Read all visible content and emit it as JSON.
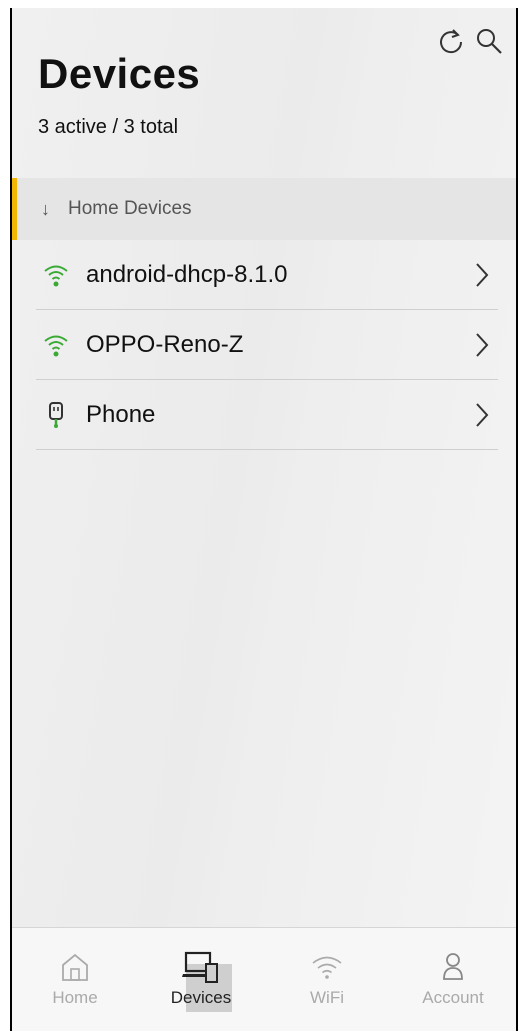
{
  "header": {
    "title": "Devices",
    "summary": "3 active / 3 total",
    "refresh_icon": "refresh-icon",
    "search_icon": "search-icon"
  },
  "section": {
    "label": "Home Devices",
    "icon": "arrow-down-icon",
    "accent_color": "#f2b705"
  },
  "devices": [
    {
      "name": "android-dhcp-8.1.0",
      "icon": "wifi-icon",
      "status_color": "#3aaa35"
    },
    {
      "name": "OPPO-Reno-Z",
      "icon": "wifi-icon",
      "status_color": "#3aaa35"
    },
    {
      "name": "Phone",
      "icon": "ethernet-icon",
      "status_color": "#3aaa35"
    }
  ],
  "tabs": [
    {
      "label": "Home",
      "icon": "home-icon",
      "active": false
    },
    {
      "label": "Devices",
      "icon": "devices-icon",
      "active": true
    },
    {
      "label": "WiFi",
      "icon": "wifi-icon",
      "active": false
    },
    {
      "label": "Account",
      "icon": "account-icon",
      "active": false
    }
  ]
}
